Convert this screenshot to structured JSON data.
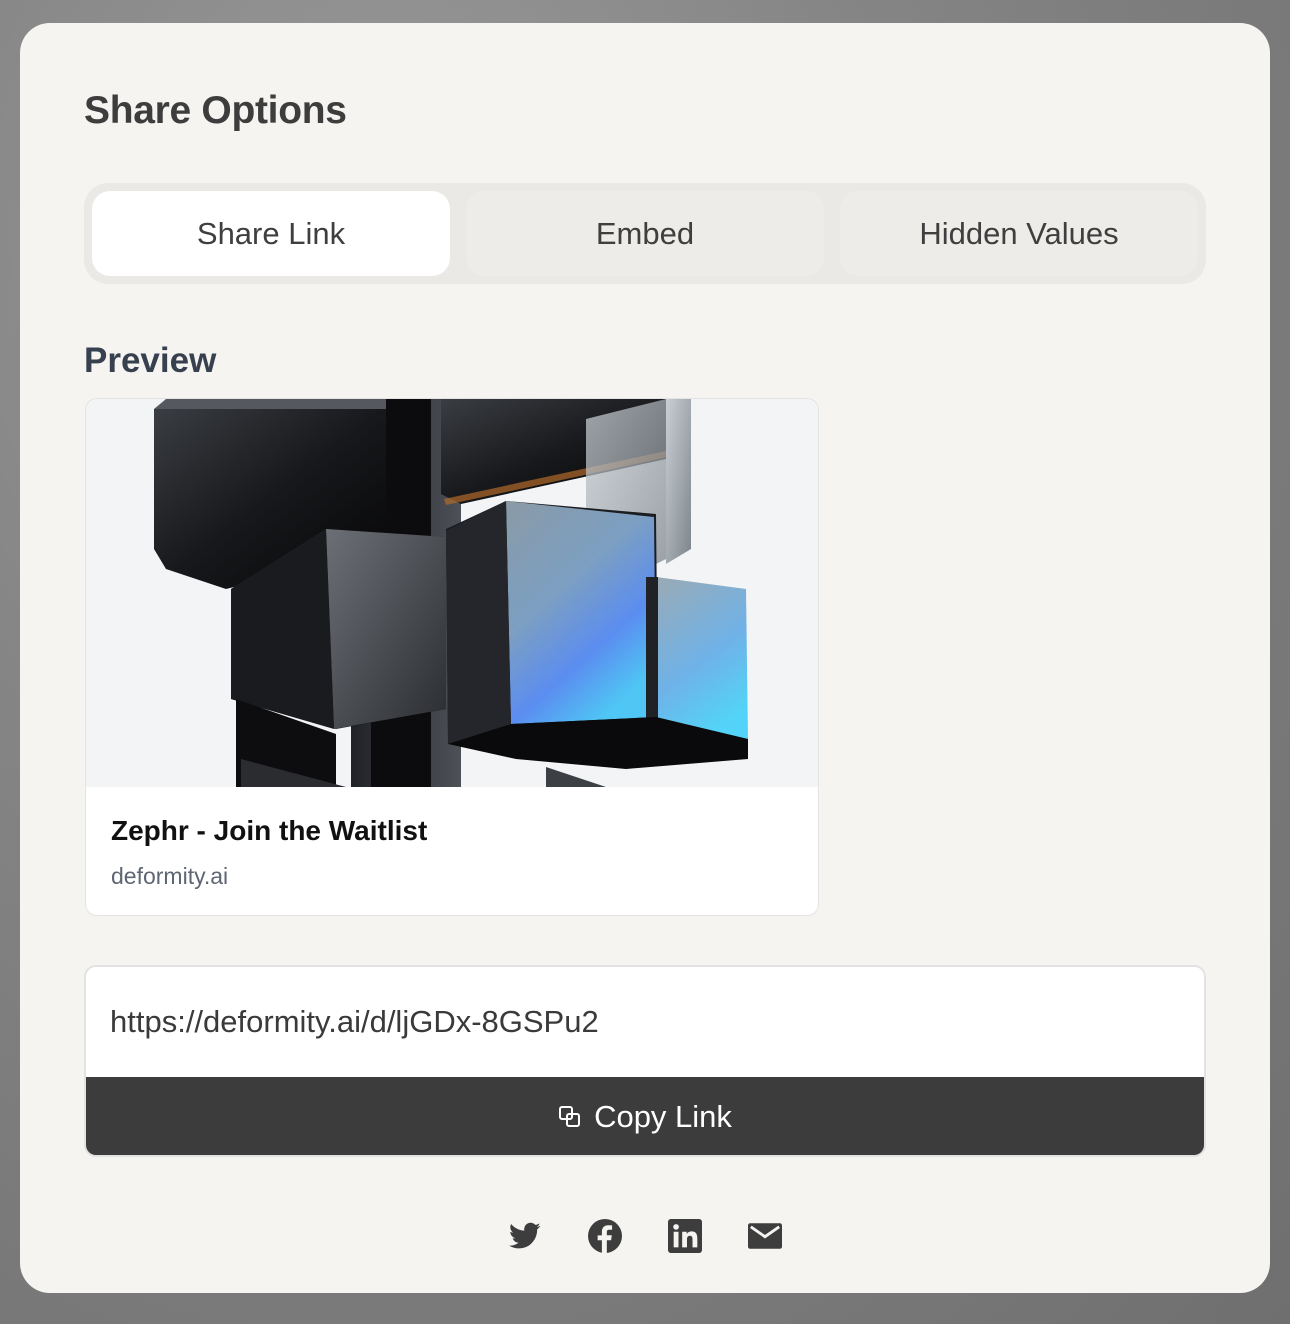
{
  "modal": {
    "title": "Share Options"
  },
  "tabs": [
    {
      "label": "Share Link",
      "active": true
    },
    {
      "label": "Embed",
      "active": false
    },
    {
      "label": "Hidden Values",
      "active": false
    }
  ],
  "preview": {
    "label": "Preview",
    "card_title": "Zephr - Join the Waitlist",
    "card_domain": "deformity.ai",
    "image_icon": "abstract-3d-cubes-image"
  },
  "share_link": {
    "url": "https://deformity.ai/d/ljGDx-8GSPu2",
    "copy_label": "Copy Link",
    "copy_icon": "copy-icon"
  },
  "social_icons": [
    "twitter-icon",
    "facebook-icon",
    "linkedin-icon",
    "email-icon"
  ],
  "colors": {
    "modal_bg": "#f5f4f1",
    "tab_bg": "#ebe9e5",
    "active_tab": "#ffffff",
    "button_bg": "#3c3c3c",
    "heading": "#3d3d3d"
  }
}
